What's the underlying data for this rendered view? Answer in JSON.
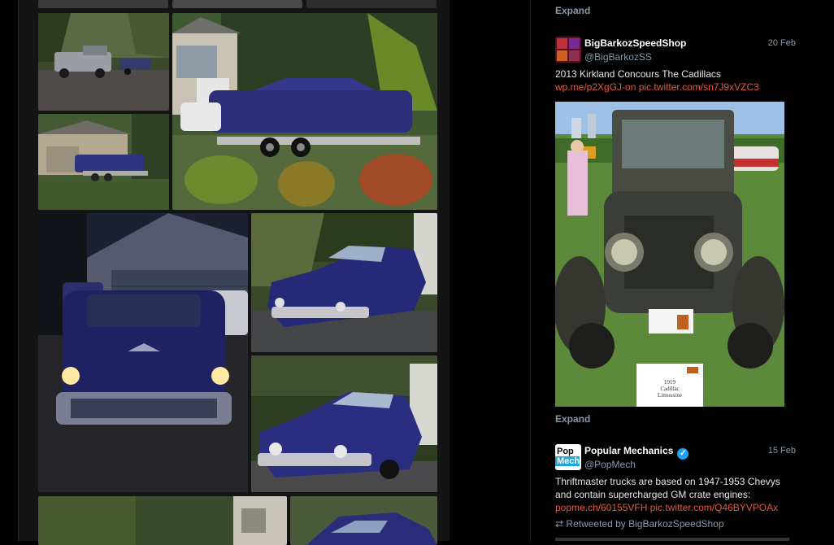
{
  "timeline": {
    "expand_label": "Expand",
    "tweets": [
      {
        "name": "BigBarkozSpeedShop",
        "handle": "@BigBarkozSS",
        "date": "20 Feb",
        "text": "2013 Kirkland Concours The Cadillacs",
        "links": [
          "wp.me/p2XgGJ-on",
          "pic.twitter.com/sn7J9xVZC3"
        ],
        "photo_placard": [
          "1919",
          "Cadillac",
          "Limousine"
        ]
      },
      {
        "name": "Popular Mechanics",
        "handle": "@PopMech",
        "date": "15 Feb",
        "verified_icon": "✓",
        "avatar_text": [
          "Pop",
          "Mech"
        ],
        "text": "Thriftmaster trucks are based on 1947-1953 Chevys and contain supercharged GM crate engines:",
        "links": [
          "popme.ch/60155VFH",
          "pic.twitter.com/Q46BYVPOAx"
        ],
        "retweet_icon": "⇄",
        "retweet_text": "Retweeted by BigBarkozSpeedShop"
      }
    ]
  },
  "colors": {
    "link": "#e45a3f",
    "muted": "#8899a6",
    "verified": "#1da1f2",
    "car_blue": "#2c2f7a"
  }
}
